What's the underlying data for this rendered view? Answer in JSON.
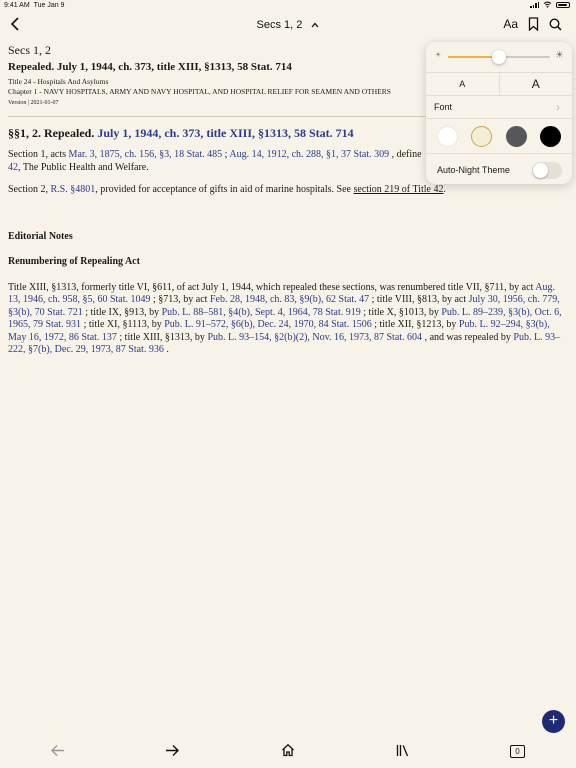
{
  "status_bar": {
    "time": "9:41 AM",
    "date": "Tue Jan 9"
  },
  "navbar": {
    "title": "Secs 1, 2",
    "text_settings_label": "Aa"
  },
  "document": {
    "secs": "Secs 1, 2",
    "heading": "Repealed. July 1, 1944, ch. 373, title XIII, §1313, 58 Stat. 714",
    "title_line": "Title 24 - Hospitals And Asylums",
    "chapter_line": "Chapter 1 - NAVY HOSPITALS, ARMY AND NAVY HOSPITAL, AND HOSPITAL RELIEF FOR SEAMEN AND OTHERS",
    "version": "Version | 2021-01-07",
    "section_prefix": "§§1, 2. Repealed.",
    "section_cite": "July 1, 1944, ch. 373, title XIII, §1313, 58 Stat. 714",
    "p1": {
      "t1": "Section 1, acts ",
      "l1": "Mar. 3, 1875, ch. 156, §3, 18 Stat. 485",
      "t2": " ; ",
      "l2": "Aug. 14, 1912, ch. 288, §1, 37 Stat. 309",
      "t3": " , define",
      "l3": "42",
      "t4": ", The Public Health and Welfare."
    },
    "p2": {
      "t1": "Section 2, ",
      "l1": "R.S. §4801",
      "t2": ", provided for acceptance of gifts in aid of marine hospitals. See ",
      "l2": "section 219 of Title 42",
      "t3": "."
    },
    "editorial_notes": "Editorial Notes",
    "renumbering": "Renumbering of Repealing Act",
    "p3": {
      "t1": "Title XIII, §1313, formerly title VI, §611, of act July 1, 1944, which repealed these sections, was renumbered title VII, §711, by act ",
      "l1": "Aug. 13, 1946, ch. 958, §5, 60 Stat. 1049",
      "t2": " ; §713, by act ",
      "l2": "Feb. 28, 1948, ch. 83, §9(b), 62 Stat. 47",
      "t3": " ; title VIII, §813, by act ",
      "l3": "July 30, 1956, ch. 779, §3(b), 70 Stat. 721",
      "t4": " ; title IX, §913, by ",
      "l4": "Pub. L. 88–581, §4(b), Sept. 4, 1964, 78 Stat. 919",
      "t5": " ; title X, §1013, by ",
      "l5": "Pub. L. 89–239, §3(b), Oct. 6, 1965, 79 Stat. 931",
      "t6": " ; title XI, §1113, by ",
      "l6": "Pub. L. 91–572, §6(b), Dec. 24, 1970, 84 Stat. 1506",
      "t7": " ; title XII, §1213, by ",
      "l7": "Pub. L. 92–294, §3(b), May 16, 1972, 86 Stat. 137",
      "t8": " ; title XIII, §1313, by ",
      "l8": "Pub. L. 93–154, §2(b)(2), Nov. 16, 1973, 87 Stat. 604",
      "t9": " , and was repealed by ",
      "l9": "Pub. L. 93–222, §7(b), Dec. 29, 1973, 87 Stat. 936",
      "t10": " ."
    }
  },
  "settings_panel": {
    "brightness": 0.5,
    "font_small": "A",
    "font_large": "A",
    "font_label": "Font",
    "themes": [
      {
        "name": "white",
        "color": "#ffffff"
      },
      {
        "name": "sepia",
        "color": "#f5edd6",
        "selected": true
      },
      {
        "name": "gray",
        "color": "#55575b"
      },
      {
        "name": "black",
        "color": "#000000"
      }
    ],
    "auto_night_label": "Auto-Night Theme",
    "auto_night_enabled": false
  },
  "toolbar": {
    "tab_count": "0"
  },
  "colors": {
    "link": "#2b3b8f",
    "accent": "#1e2a78",
    "background": "#f7f3e8",
    "slider_fill": "#f0b33c"
  }
}
